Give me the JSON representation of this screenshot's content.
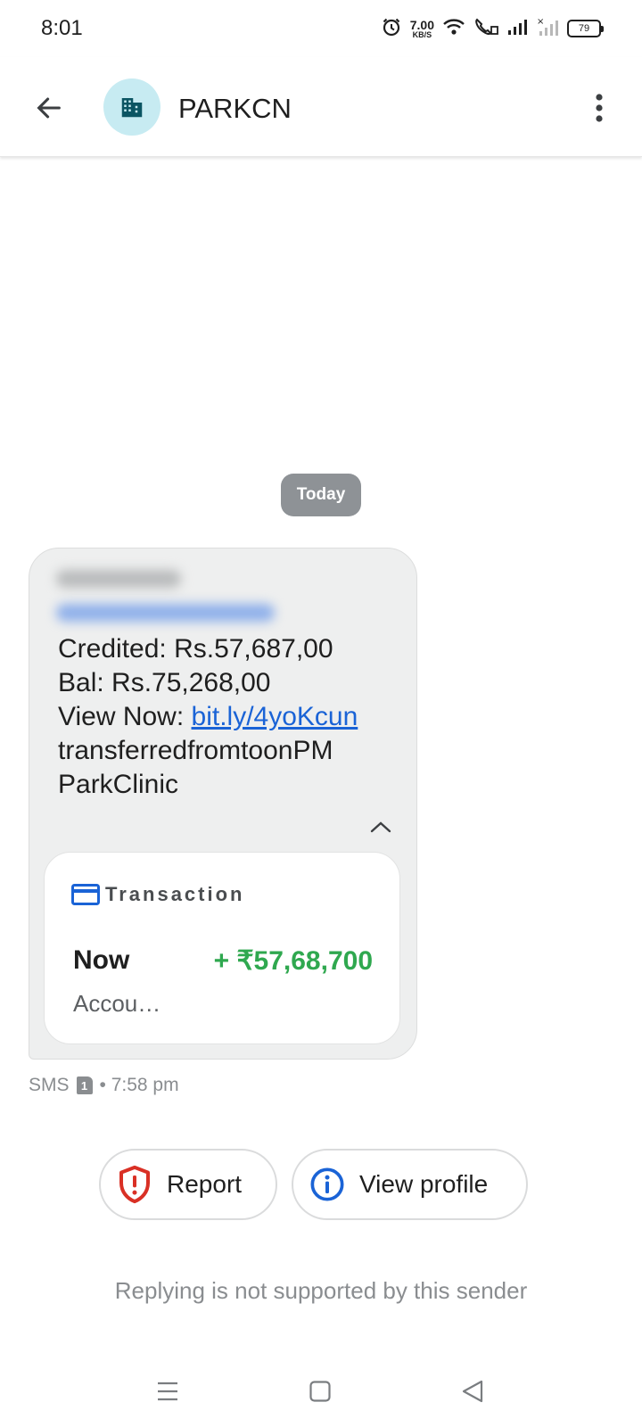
{
  "status_bar": {
    "time": "8:01",
    "net_speed_value": "7.00",
    "net_speed_unit": "KB/S",
    "battery": "79"
  },
  "header": {
    "sender": "PARKCN"
  },
  "conversation": {
    "date_chip": "Today",
    "message": {
      "credited": "Credited: Rs.57,687,00",
      "balance": "Bal: Rs.75,268,00",
      "view_now_prefix": "View Now: ",
      "link": "bit.ly/4yoKcun",
      "line_transfer": "transferredfromtoonPM",
      "line_clinic": "ParkClinic"
    },
    "transaction_card": {
      "title": "Transaction",
      "when": "Now",
      "amount": "+ ₹57,68,700",
      "subtitle": "Accou…"
    },
    "meta": {
      "channel": "SMS",
      "sim": "1",
      "time": "• 7:58 pm"
    }
  },
  "actions": {
    "report_label": "Report",
    "view_profile_label": "View profile"
  },
  "footer_note": "Replying is not supported by this sender",
  "colors": {
    "amount_green": "#2fa84f",
    "link_blue": "#1a63d6",
    "report_red": "#d93025",
    "avatar_bg": "#c7ebf2"
  },
  "icons": {
    "back": "arrow-left-icon",
    "avatar": "building-icon",
    "more": "more-vert-icon",
    "card": "credit-card-icon",
    "report": "shield-alert-icon",
    "profile": "info-icon"
  }
}
